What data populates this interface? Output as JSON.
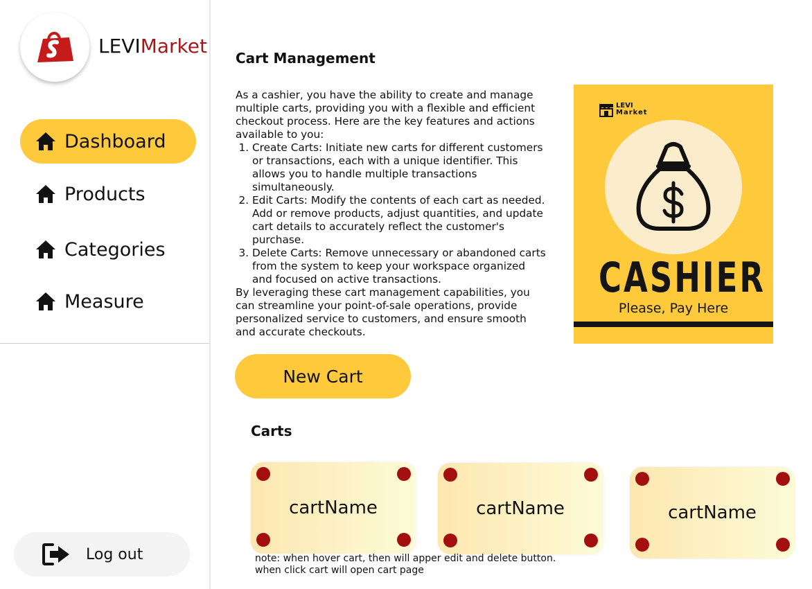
{
  "brand": {
    "name_part1": "LEVI",
    "name_part2": "Market",
    "accent_color": "#a4171a"
  },
  "sidebar": {
    "items": [
      {
        "label": "Dashboard",
        "icon": "home-icon",
        "active": true
      },
      {
        "label": "Products",
        "icon": "home-icon",
        "active": false
      },
      {
        "label": "Categories",
        "icon": "home-icon",
        "active": false
      },
      {
        "label": "Measure",
        "icon": "home-icon",
        "active": false
      }
    ],
    "logout_label": "Log out",
    "logout_icon": "logout-icon",
    "active_color": "#ffc93c"
  },
  "main": {
    "title": "Cart Management",
    "intro": "As a cashier, you have the ability to create and manage multiple carts, providing you with a flexible and efficient checkout process. Here are the key features and actions available to you:",
    "features": [
      "Create Carts: Initiate new carts for different customers or transactions, each with a unique identifier. This allows you to handle multiple transactions simultaneously.",
      "Edit Carts: Modify the contents of each cart as needed. Add or remove products, adjust quantities, and update cart details to accurately reflect the customer's purchase.",
      "Delete Carts: Remove unnecessary or abandoned carts from the system to keep your workspace organized and focused on active transactions."
    ],
    "outro": "By leveraging these cart management capabilities, you can streamline your point-of-sale operations, provide personalized service to customers, and ensure smooth and accurate checkouts.",
    "new_cart_label": "New Cart",
    "carts_title": "Carts",
    "carts": [
      {
        "name": "cartName"
      },
      {
        "name": "cartName"
      },
      {
        "name": "cartName"
      }
    ],
    "note_line1": "note: when hover cart, then will apper edit and delete button.",
    "note_line2": "when click cart will open cart page"
  },
  "poster": {
    "logo_line1": "LEVI",
    "logo_line2": "Market",
    "title": "CASHIER",
    "subtitle": "Please, Pay Here",
    "background_color": "#ffc93c",
    "icon": "money-bag-icon"
  }
}
